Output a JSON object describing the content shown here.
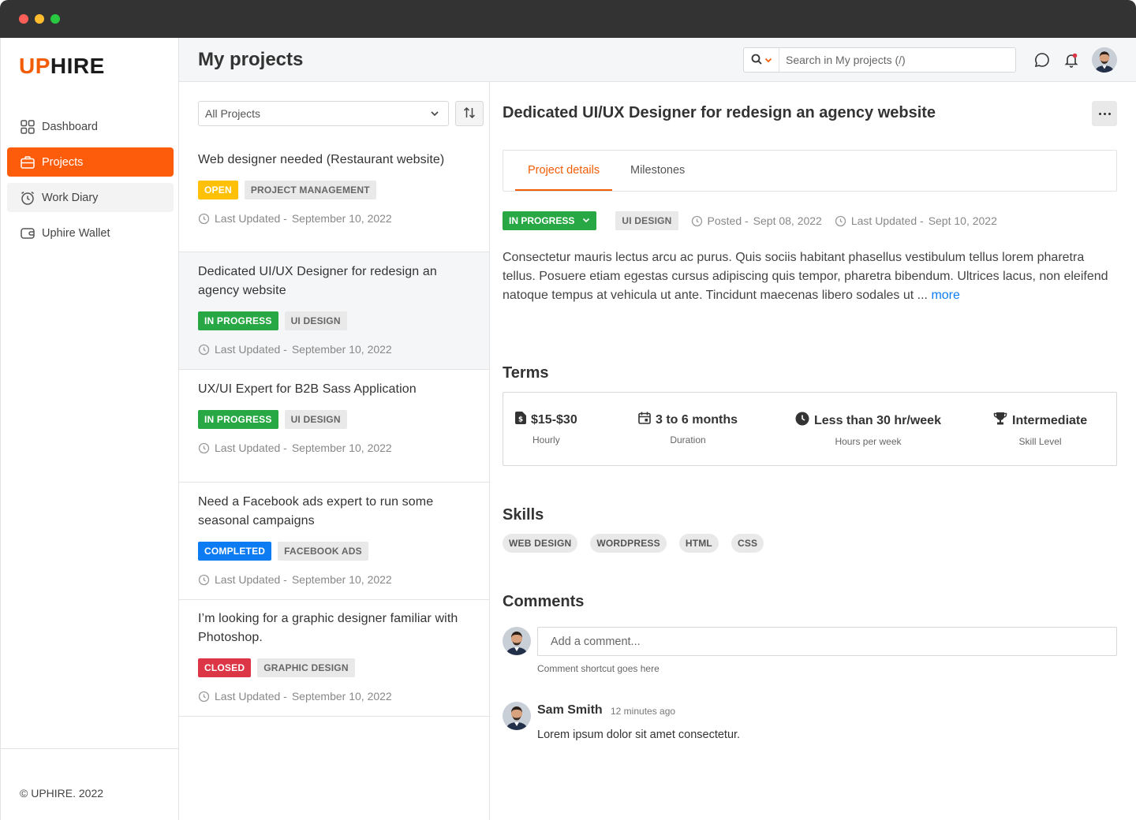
{
  "brand": {
    "logo_up": "UP",
    "logo_hire": "HIRE",
    "accent": "#fd5d0b"
  },
  "sidebar": {
    "items": [
      {
        "label": "Dashboard",
        "icon": "grid-icon"
      },
      {
        "label": "Projects",
        "icon": "briefcase-icon"
      },
      {
        "label": "Work Diary",
        "icon": "alarm-clock-icon"
      },
      {
        "label": "Uphire Wallet",
        "icon": "wallet-icon"
      }
    ],
    "copyright": "© UPHIRE. 2022"
  },
  "header": {
    "title": "My projects",
    "search_placeholder": "Search in My projects (/)"
  },
  "list": {
    "filter_value": "All Projects",
    "updated_label": "Last Updated -",
    "projects": [
      {
        "title": "Web designer needed (Restaurant website)",
        "status": "OPEN",
        "category": "PROJECT MANAGEMENT",
        "updated": "September 10, 2022"
      },
      {
        "title": "Dedicated UI/UX Designer for redesign an agency website",
        "status": "IN PROGRESS",
        "category": "UI DESIGN",
        "updated": "September 10, 2022"
      },
      {
        "title": "UX/UI Expert for B2B Sass Application",
        "status": "IN PROGRESS",
        "category": "UI DESIGN",
        "updated": "September 10, 2022"
      },
      {
        "title": "Need a Facebook ads expert to run some seasonal campaigns",
        "status": "COMPLETED",
        "category": "FACEBOOK ADS",
        "updated": "September 10, 2022"
      },
      {
        "title": "I’m looking for a graphic designer familiar with Photoshop.",
        "status": "CLOSED",
        "category": "GRAPHIC DESIGN",
        "updated": "September 10, 2022"
      }
    ]
  },
  "detail": {
    "title": "Dedicated UI/UX Designer for redesign an agency website",
    "tabs": [
      "Project details",
      "Milestones"
    ],
    "status": "IN PROGRESS",
    "category": "UI DESIGN",
    "posted_label": "Posted -",
    "posted": "Sept 08, 2022",
    "updated_label": "Last Updated -",
    "updated": "Sept 10, 2022",
    "description": "Consectetur mauris lectus arcu ac purus. Quis sociis habitant phasellus vestibulum tellus lorem pharetra tellus. Posuere etiam egestas cursus adipiscing quis tempor, pharetra bibendum. Ultrices lacus, non eleifend natoque tempus at vehicula ut ante. Tincidunt maecenas libero sodales ut ...",
    "more_link": "more",
    "terms_heading": "Terms",
    "terms": [
      {
        "value": "$15-$30",
        "label": "Hourly",
        "icon": "dollar-doc-icon"
      },
      {
        "value": "3 to 6 months",
        "label": "Duration",
        "icon": "calendar-icon"
      },
      {
        "value": "Less than 30 hr/week",
        "label": "Hours per week",
        "icon": "clock-icon"
      },
      {
        "value": "Intermediate",
        "label": "Skill Level",
        "icon": "trophy-icon"
      }
    ],
    "skills_heading": "Skills",
    "skills": [
      "WEB DESIGN",
      "WORDPRESS",
      "HTML",
      "CSS"
    ],
    "comments_heading": "Comments",
    "comment_placeholder": "Add a comment...",
    "comment_hint": "Comment shortcut goes here",
    "comment": {
      "author": "Sam Smith",
      "time": "12 minutes ago",
      "text": "Lorem ipsum dolor sit amet consectetur."
    }
  }
}
